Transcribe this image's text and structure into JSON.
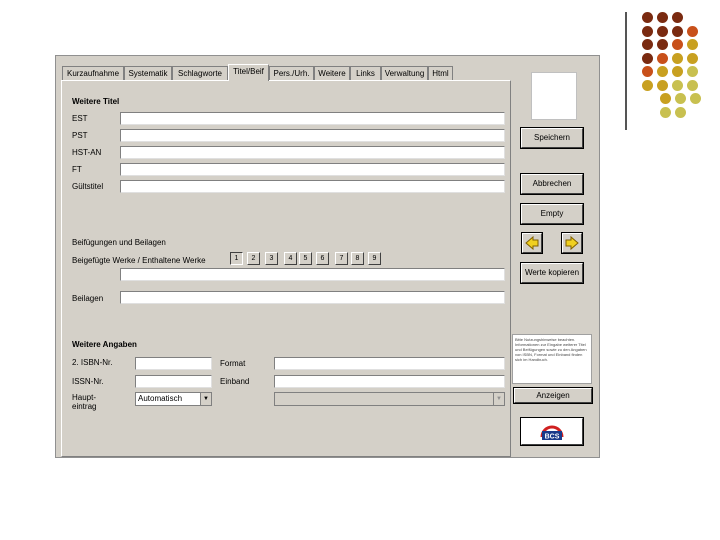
{
  "colors": {
    "window_bg": "#d4d0c8",
    "dot_dark": "#7a2a10",
    "dot_orange": "#c8501a",
    "dot_gold": "#c8a020",
    "dot_olive": "#c8c050"
  },
  "tabs": [
    {
      "label": "Kurzaufnahme"
    },
    {
      "label": "Systematik"
    },
    {
      "label": "Schlagworte"
    },
    {
      "label": "Titel/Beif"
    },
    {
      "label": "Pers./Urh."
    },
    {
      "label": "Weitere"
    },
    {
      "label": "Links"
    },
    {
      "label": "Verwaltung"
    },
    {
      "label": "Html"
    }
  ],
  "active_tab": "Titel/Beif",
  "section_titles": {
    "weitere_titel": "Weitere Titel",
    "beifuegungen": "Beifügungen und Beilagen",
    "weitere_angaben": "Weitere Angaben"
  },
  "weitere_titel_fields": [
    {
      "label": "EST",
      "value": ""
    },
    {
      "label": "PST",
      "value": ""
    },
    {
      "label": "HST-AN",
      "value": ""
    },
    {
      "label": "FT",
      "value": ""
    },
    {
      "label": "Gültstitel",
      "value": ""
    }
  ],
  "beif": {
    "label": "Beigefügte Werke / Enthaltene Werke",
    "numbers": [
      "1",
      "2",
      "3",
      "4",
      "5",
      "6",
      "7",
      "8",
      "9"
    ],
    "selected": "1",
    "value": "",
    "beilagen_label": "Beilagen",
    "beilagen_value": ""
  },
  "angaben": {
    "isbn_label": "2. ISBN-Nr.",
    "isbn_value": "",
    "issn_label": "ISSN-Nr.",
    "issn_value": "",
    "format_label": "Format",
    "format_value": "",
    "einband_label": "Einband",
    "einband_value": "",
    "haupt_label_1": "Haupt-",
    "haupt_label_2": "eintrag",
    "haupt_value": "Automatisch",
    "arrow": "▼"
  },
  "side": {
    "save": "Speichern",
    "cancel": "Abbrechen",
    "empty": "Empty",
    "copy": "Werte kopieren",
    "show": "Anzeigen",
    "logo": "BCS"
  },
  "info_text": "Bitte Nutzungshinweise beachten. Informationen zur Eingabe weiterer Titel und Beifügungen sowie zu den Angaben von ISBN, Format und Einband finden sich im Handbuch."
}
